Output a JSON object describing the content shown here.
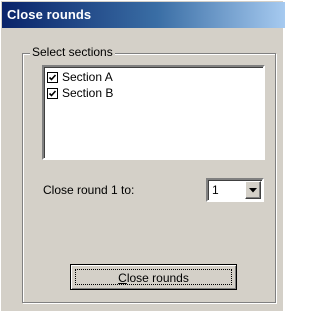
{
  "window": {
    "title": "Close rounds"
  },
  "group": {
    "legend": "Select sections",
    "sections": [
      {
        "label": "Section A",
        "checked": true
      },
      {
        "label": "Section B",
        "checked": true
      }
    ]
  },
  "close_round": {
    "label": "Close round 1 to:",
    "selected_value": "1"
  },
  "action": {
    "button_mnemonic": "C",
    "button_rest": "lose rounds"
  },
  "icons": {
    "checkbox_mark": "checkmark-icon",
    "dropdown": "chevron-down-icon"
  }
}
